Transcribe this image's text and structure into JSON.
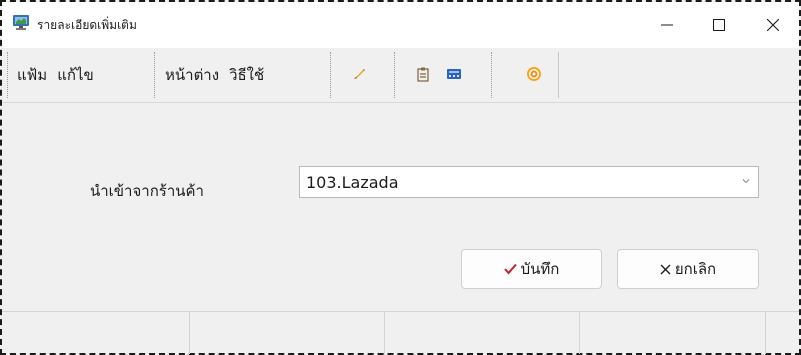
{
  "window": {
    "title": "รายละเอียดเพิ่มเติม",
    "app_icon": "monitor-app-icon",
    "controls": [
      "minimize-icon",
      "maximize-icon",
      "close-icon"
    ]
  },
  "menu": {
    "items": [
      {
        "label": "แฟ้ม"
      },
      {
        "label": "แก้ไข"
      },
      {
        "label": "หน้าต่าง"
      },
      {
        "label": "วิธีใช้"
      }
    ]
  },
  "toolbar": {
    "icons": [
      "pencil-icon",
      "clipboard-icon",
      "calculator-icon",
      "target-icon"
    ]
  },
  "form": {
    "import_label": "นำเข้าจากร้านค้า",
    "store_selected": "103.Lazada"
  },
  "buttons": {
    "save_label": "บันทึก",
    "cancel_label": "ยกเลิก"
  },
  "colors": {
    "save_check": "#c0262b",
    "window_bg": "#f0f0f0",
    "titlebar_bg": "#ffffff"
  }
}
